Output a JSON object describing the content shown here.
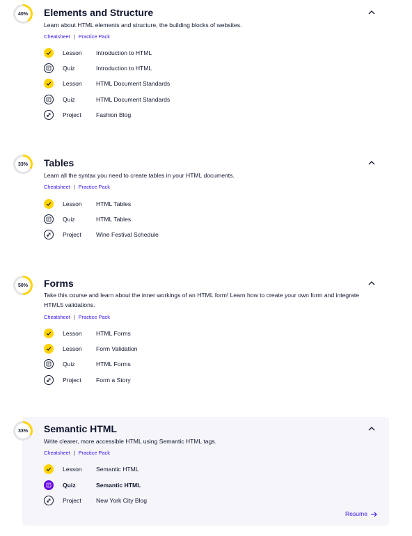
{
  "modules": [
    {
      "percent": "40%",
      "progress": 0.4,
      "title": "Elements and Structure",
      "description": "Learn about HTML elements and structure, the building blocks of websites.",
      "cheatsheet": "Cheatsheet",
      "practice": "Practice Pack",
      "items": [
        {
          "type": "Lesson",
          "name": "Introduction to HTML",
          "status": "done"
        },
        {
          "type": "Quiz",
          "name": "Introduction to HTML",
          "status": "todo",
          "icon": "quiz-icon"
        },
        {
          "type": "Lesson",
          "name": "HTML Document Standards",
          "status": "done"
        },
        {
          "type": "Quiz",
          "name": "HTML Document Standards",
          "status": "todo",
          "icon": "quiz-icon"
        },
        {
          "type": "Project",
          "name": "Fashion Blog",
          "status": "todo",
          "icon": "project-icon"
        }
      ]
    },
    {
      "percent": "33%",
      "progress": 0.33,
      "title": "Tables",
      "description": "Learn all the syntax you need to create tables in your HTML documents.",
      "cheatsheet": "Cheatsheet",
      "practice": "Practice Pack",
      "items": [
        {
          "type": "Lesson",
          "name": "HTML Tables",
          "status": "done"
        },
        {
          "type": "Quiz",
          "name": "HTML Tables",
          "status": "todo",
          "icon": "quiz-icon"
        },
        {
          "type": "Project",
          "name": "Wine Festival Schedule",
          "status": "todo",
          "icon": "project-icon"
        }
      ]
    },
    {
      "percent": "50%",
      "progress": 0.5,
      "title": "Forms",
      "description": "Take this course and learn about the inner workings of an HTML form! Learn how to create your own form and integrate HTML5 validations.",
      "cheatsheet": "Cheatsheet",
      "practice": "Practice Pack",
      "items": [
        {
          "type": "Lesson",
          "name": "HTML Forms",
          "status": "done"
        },
        {
          "type": "Lesson",
          "name": "Form Validation",
          "status": "done"
        },
        {
          "type": "Quiz",
          "name": "HTML Forms",
          "status": "todo",
          "icon": "quiz-icon"
        },
        {
          "type": "Project",
          "name": "Form a Story",
          "status": "todo",
          "icon": "project-icon"
        }
      ]
    },
    {
      "percent": "33%",
      "progress": 0.33,
      "title": "Semantic HTML",
      "description": "Write clearer, more accessible HTML using Semantic HTML tags.",
      "cheatsheet": "Cheatsheet",
      "practice": "Practice Pack",
      "items": [
        {
          "type": "Lesson",
          "name": "Semantic HTML",
          "status": "done"
        },
        {
          "type": "Quiz",
          "name": "Semantic HTML",
          "status": "current",
          "icon": "quiz-icon"
        },
        {
          "type": "Project",
          "name": "New York City Blog",
          "status": "todo",
          "icon": "project-icon"
        }
      ],
      "resume": "Resume"
    }
  ],
  "colors": {
    "progress": "#ffd300",
    "track": "#e3e3e8",
    "link": "#3a10e5",
    "current": "#6400e4",
    "panel": "#f5f5fa",
    "text": "#10162f"
  }
}
